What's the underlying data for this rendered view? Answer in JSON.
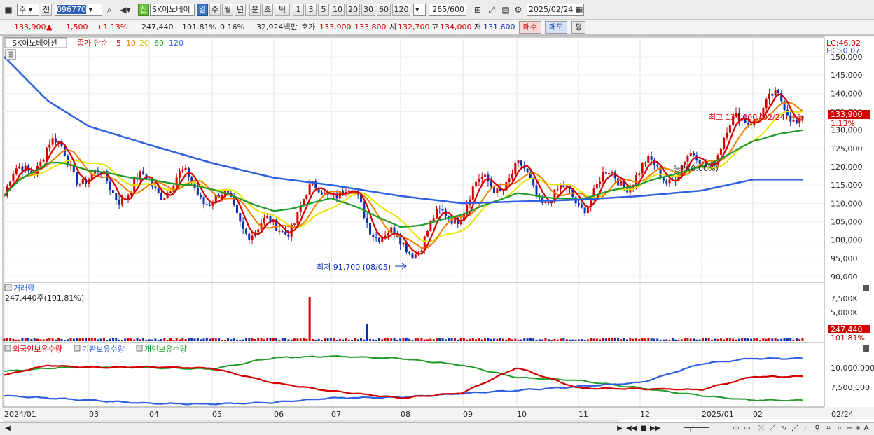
{
  "toolbar": {
    "market": "주",
    "prev": "전",
    "code": "096770",
    "badge": "신",
    "stock_name": "SK이노베이",
    "periods": [
      "일",
      "주",
      "월",
      "년",
      "분",
      "초",
      "틱"
    ],
    "intervals": [
      "1",
      "3",
      "5",
      "10",
      "20",
      "30",
      "60",
      "120"
    ],
    "count": "265",
    "count_total": "/600",
    "date": "2025/02/24"
  },
  "quote": {
    "price": "133,900",
    "arrow": "▲",
    "change": "1,500",
    "change_pct": "+1.13%",
    "volume": "247,440",
    "volume_ratio": "101.81%",
    "turnover_pct": "0.16%",
    "amount": "32,924백만",
    "bid_label": "호가",
    "bid1": "133,900",
    "bid2": "133,800",
    "open_label": "시",
    "open": "132,700",
    "high_label": "고",
    "high": "134,000",
    "low_label": "저",
    "low": "131,600",
    "buy": "매수",
    "sell": "매도",
    "eval": "평"
  },
  "price_pane": {
    "stock_label": "SK이노베이션",
    "ma_label": "종가 단순",
    "ma_periods": [
      "5",
      "10",
      "20",
      "60",
      "120"
    ],
    "ma_colors": [
      "#d40000",
      "#f08000",
      "#e6e600",
      "#1f9a2a",
      "#2f5fe0"
    ],
    "lc": "LC:46.02",
    "hc": "HC:-0.07",
    "y_ticks": [
      "150,000",
      "145,000",
      "140,000",
      "135,000",
      "130,000",
      "125,000",
      "120,000",
      "115,000",
      "110,000",
      "105,000",
      "100,000",
      "95,000",
      "90,000"
    ],
    "last_price": "133,900",
    "last_pct": "1.13%",
    "high_annotation": "최고 134,000 (02/24)",
    "low_annotation": "최저 91,700 (08/05)",
    "mid_annotation": "등락(0.00%)"
  },
  "volume_pane": {
    "title": "거래량",
    "summary": "247,440주(101.81%)",
    "y_ticks": [
      "7,500K",
      "5,000K",
      "2,500K"
    ],
    "last": "247,440",
    "last_pct": "101.81%"
  },
  "holding_pane": {
    "legend": [
      "외국인보유수량",
      "기관보유수량",
      "개인보유수량"
    ],
    "colors": [
      "#d40000",
      "#2f5fe0",
      "#1f9a2a"
    ],
    "y_ticks": [
      "10,000,000",
      "7,500,000"
    ]
  },
  "x_axis": [
    "2024/01",
    "03",
    "04",
    "05",
    "06",
    "07",
    "08",
    "09",
    "10",
    "11",
    "12",
    "2025/01",
    "02"
  ],
  "x_axis_right": "02/24",
  "chart_data": {
    "type": "line",
    "price_close_by_month": {
      "x": [
        "2024/01",
        "02",
        "03",
        "04",
        "05",
        "06",
        "07",
        "08",
        "09",
        "10",
        "11",
        "12",
        "2025/01",
        "02"
      ],
      "values": [
        112000,
        123000,
        118000,
        115000,
        111000,
        104000,
        113000,
        100000,
        108000,
        118000,
        112000,
        116000,
        124000,
        133900
      ]
    },
    "ma120_by_month": [
      150000,
      138000,
      131000,
      126000,
      121000,
      117000,
      115000,
      112000,
      110000,
      110500,
      111000,
      112000,
      113500,
      116500
    ],
    "ymin": 90000,
    "ymax": 150000,
    "volume_spikes": [
      {
        "x": "06",
        "value": 8500000
      },
      {
        "x": "07",
        "value": 3300000
      }
    ],
    "holdings_by_month": {
      "foreign": [
        9500000,
        10800000,
        10500000,
        10600000,
        10400000,
        8500000,
        7400000,
        6500000,
        7200000,
        10500000,
        7800000,
        7700000,
        7600000,
        9300000
      ],
      "institution": [
        6800000,
        6500000,
        6200000,
        5800000,
        5700000,
        5900000,
        6500000,
        6600000,
        7100000,
        7500000,
        8000000,
        8500000,
        11000000,
        11700000
      ],
      "individual": [
        10000000,
        10400000,
        10600000,
        10500000,
        10300000,
        11800000,
        12000000,
        11700000,
        10800000,
        9200000,
        8800000,
        7800000,
        6800000,
        6200000
      ]
    }
  }
}
